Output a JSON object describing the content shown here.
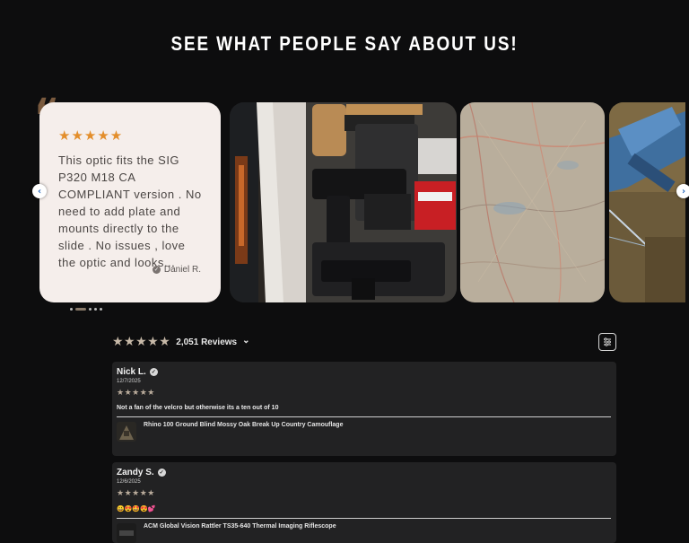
{
  "section": {
    "title": "SEE WHAT PEOPLE SAY ABOUT US!"
  },
  "featured": {
    "stars": "★★★★★",
    "text": "This optic fits the SIG P320 M18 CA COMPLIANT version . No need to add plate and mounts directly to the slide . No issues , love the optic and looks...",
    "author": "Daniel R."
  },
  "gallery": {
    "prev_icon": "chevron-left-icon",
    "next_icon": "chevron-right-icon",
    "prev_glyph": "‹",
    "next_glyph": "›"
  },
  "summary": {
    "stars": "★★★★★",
    "count_label": "2,051 Reviews",
    "chevron": "⌄"
  },
  "reviews": [
    {
      "name": "Nick L.",
      "date": "12/7/2025",
      "stars": "★★★★★",
      "body": "Not a fan of the velcro but otherwise its a ten out of 10",
      "product": "Rhino 100 Ground Blind Mossy Oak Break Up Country Camouflage"
    },
    {
      "name": "Zandy S.",
      "date": "12/6/2025",
      "stars": "★★★★★",
      "body": "😀😍🤩😍💕",
      "product": "ACM Global Vision Rattler TS35-640 Thermal Imaging Riflescope"
    }
  ],
  "colors": {
    "background": "#0d0d0e",
    "card": "#f5eeeb",
    "star_orange": "#e38e2b",
    "review_bg": "#222223",
    "quote": "#7a5a3e"
  }
}
